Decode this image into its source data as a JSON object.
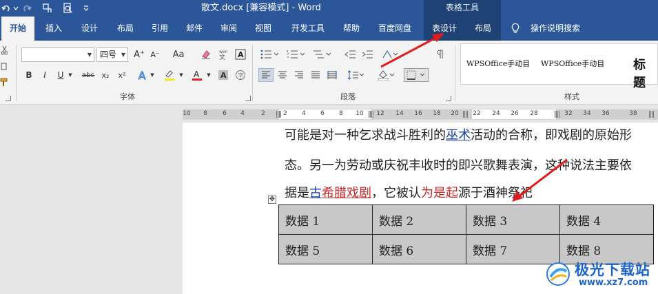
{
  "app": {
    "document_title": "散文.docx [兼容模式] - Word",
    "context_group": "表格工具",
    "accent": "#2b579a",
    "context_accent": "#1e4274"
  },
  "quick_access": {
    "icons": [
      "redo-icon",
      "undo-icon",
      "touch-mode-icon",
      "print-preview-icon",
      "customize-toolbar-icon"
    ]
  },
  "tabs": [
    {
      "label": "开始",
      "active": true
    },
    {
      "label": "插入"
    },
    {
      "label": "设计"
    },
    {
      "label": "布局"
    },
    {
      "label": "引用"
    },
    {
      "label": "邮件"
    },
    {
      "label": "审阅"
    },
    {
      "label": "视图"
    },
    {
      "label": "开发工具"
    },
    {
      "label": "帮助"
    },
    {
      "label": "百度网盘"
    },
    {
      "label": "表设计",
      "contextual": true
    },
    {
      "label": "布局",
      "contextual": true
    }
  ],
  "search": {
    "label": "操作说明搜索"
  },
  "ribbon": {
    "font": {
      "family_value": "",
      "size_value": "四号",
      "group_label": "字体",
      "buttons": [
        "B",
        "I",
        "U",
        "abc",
        "x₂",
        "x²",
        "A⁺",
        "A⁻",
        "Aa",
        "A"
      ]
    },
    "paragraph": {
      "group_label": "段落"
    },
    "styles": {
      "group_label": "样式",
      "items": [
        "WPSOffice手动目",
        "WPSOffice手动目",
        "标题"
      ]
    }
  },
  "ruler": {
    "ticks": [
      "10",
      "8",
      "6",
      "4",
      "2",
      "2",
      "4",
      "6",
      "8",
      "10",
      "12",
      "14",
      "16",
      "18",
      "20",
      "22",
      "24",
      "26",
      "28",
      "32",
      "34",
      "36",
      "38"
    ]
  },
  "document": {
    "line1": {
      "before": "可能是对一种乞求战斗胜利的",
      "link": "巫术",
      "after": "活动的合称，即戏剧的原始形"
    },
    "line2": {
      "text": "态。另一为劳动或庆祝丰收时的即兴歌舞表演，这种说法主要依"
    },
    "line3": {
      "before": "据是",
      "link_blue": "古",
      "link_red": "希腊戏剧",
      "mid": "，它被认",
      "red": "为是起",
      "after": "源于酒神祭祀"
    },
    "table": [
      [
        "数据 1",
        "数据 2",
        "数据 3",
        "数据 4"
      ],
      [
        "数据 5",
        "数据 6",
        "数据 7",
        "数据 8"
      ]
    ]
  },
  "watermark": {
    "name": "极光下载站",
    "url": "www.xz7.com"
  }
}
